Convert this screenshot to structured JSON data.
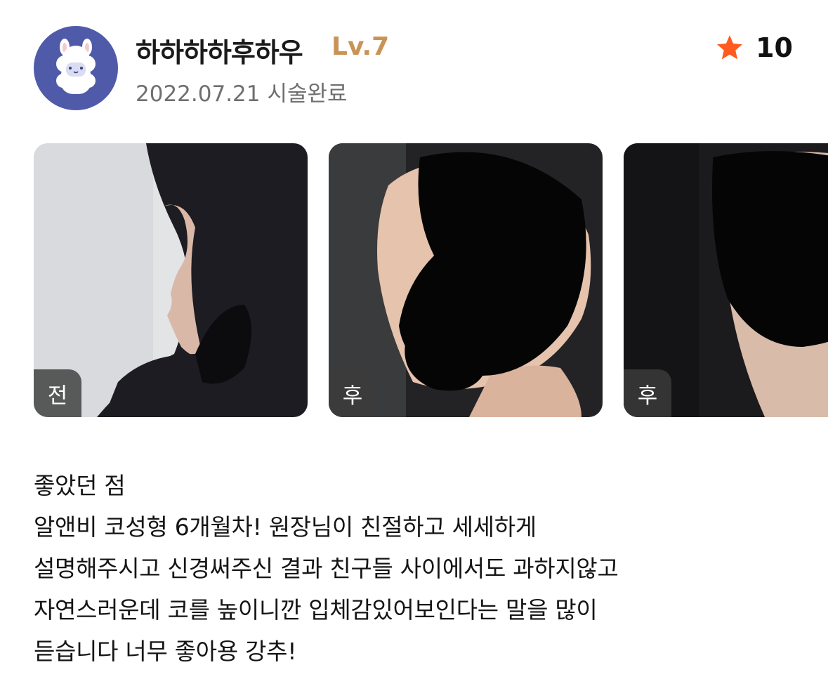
{
  "user": {
    "name": "하하하하후하우",
    "level": "Lv.7",
    "date": "2022.07.21",
    "status": "시술완료",
    "avatar_icon": "alpaca-icon"
  },
  "rating": {
    "icon": "star-icon",
    "value": "10",
    "star_color": "#ff5a1f"
  },
  "photos": [
    {
      "tag": "전"
    },
    {
      "tag": "후"
    },
    {
      "tag": "후"
    }
  ],
  "review": {
    "heading": "좋았던 점",
    "lines": [
      "알앤비 코성형 6개월차! 원장님이 친절하고 세세하게",
      "설명해주시고 신경써주신 결과 친구들 사이에서도 과하지않고",
      "자연스러운데 코를 높이니깐 입체감있어보인다는 말을 많이",
      "듣습니다 너무 좋아용 강추!"
    ]
  },
  "colors": {
    "avatar_bg": "#4f5aa9",
    "level": "#c89456",
    "meta": "#6f6f6f"
  }
}
